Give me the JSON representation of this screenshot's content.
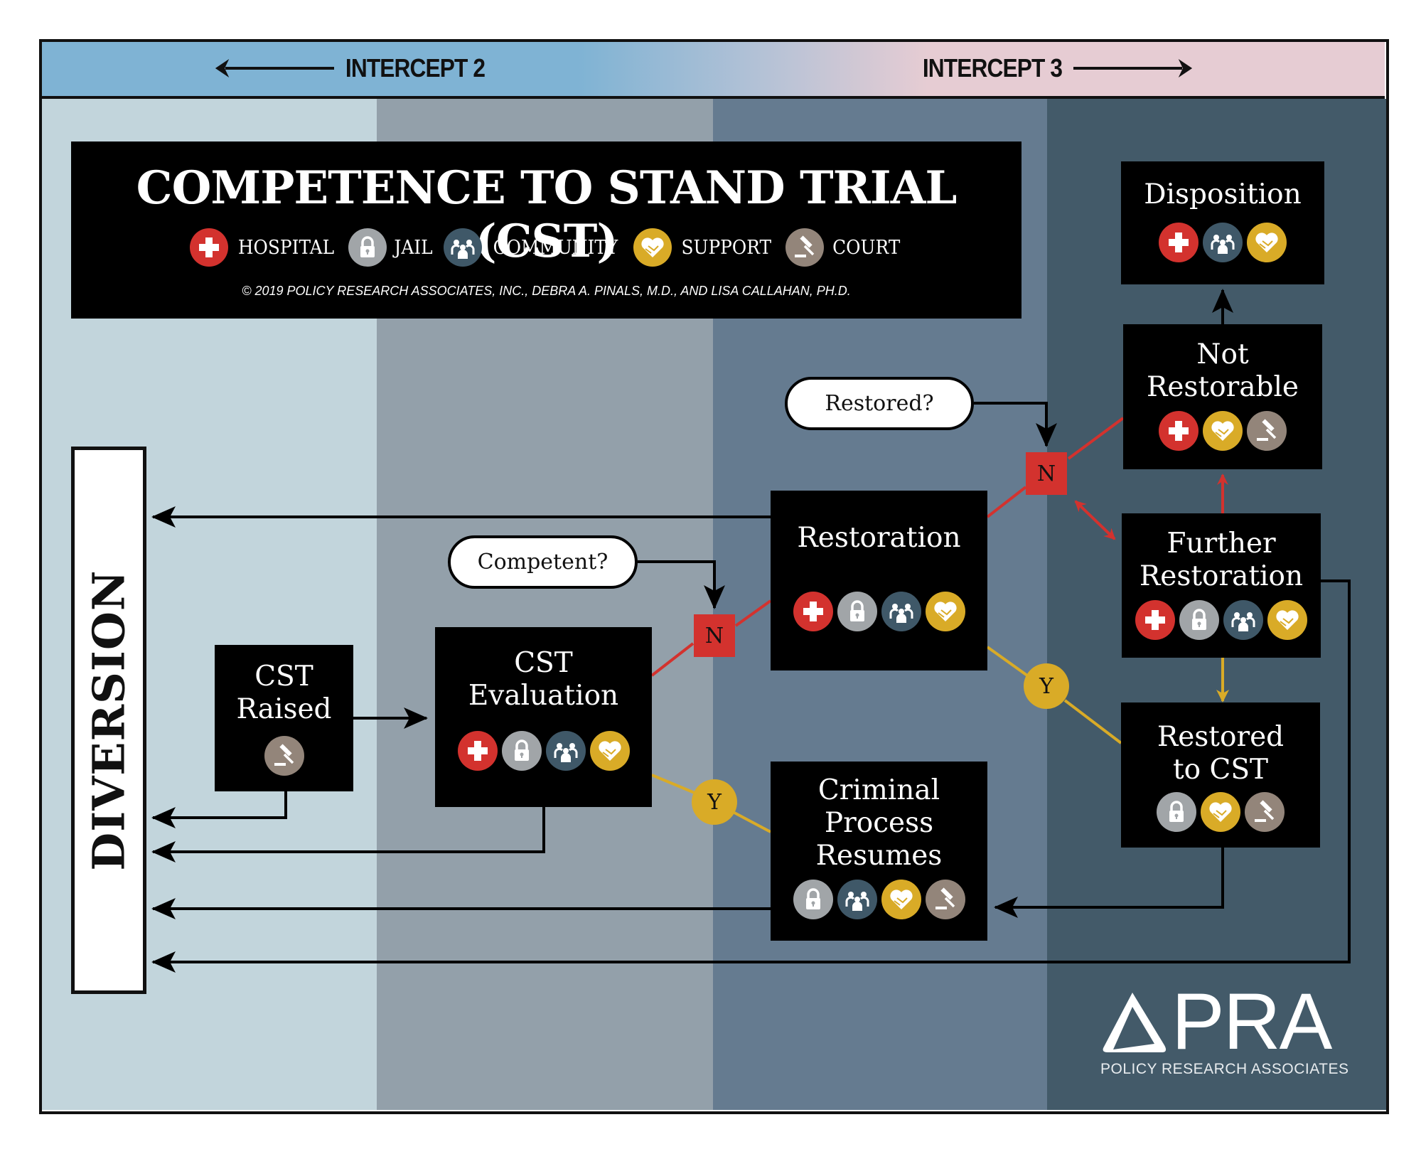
{
  "header": {
    "intercept_left": "INTERCEPT 2",
    "intercept_right": "INTERCEPT 3"
  },
  "colors": {
    "hospital": "#d3322e",
    "jail": "#a1a5a8",
    "community": "#3f5868",
    "support": "#d9ab27",
    "court": "#93857a",
    "no_path": "#d3322e",
    "yes_path": "#d9ab27",
    "col1": "#c2d5dc",
    "col2": "#93a0aa",
    "col3": "#657b90",
    "col4": "#435a69"
  },
  "title": {
    "text": "COMPETENCE TO STAND TRIAL (CST)",
    "copyright": "© 2019 POLICY RESEARCH ASSOCIATES, INC., DEBRA A. PINALS, M.D., AND LISA CALLAHAN, PH.D.",
    "legend": [
      {
        "icon": "hospital-icon",
        "label": "HOSPITAL"
      },
      {
        "icon": "jail-icon",
        "label": "JAIL"
      },
      {
        "icon": "community-icon",
        "label": "COMMUNITY"
      },
      {
        "icon": "support-icon",
        "label": "SUPPORT"
      },
      {
        "icon": "court-icon",
        "label": "COURT"
      }
    ]
  },
  "diversion": {
    "label": "DIVERSION"
  },
  "nodes": {
    "cst_raised": {
      "line1": "CST",
      "line2": "Raised",
      "icons": [
        "court"
      ]
    },
    "cst_evaluation": {
      "line1": "CST",
      "line2": "Evaluation",
      "icons": [
        "hospital",
        "jail",
        "community",
        "support"
      ]
    },
    "restoration": {
      "line1": "Restoration",
      "icons": [
        "hospital",
        "jail",
        "community",
        "support"
      ]
    },
    "criminal_process": {
      "line1": "Criminal",
      "line2": "Process",
      "line3": "Resumes",
      "icons": [
        "jail",
        "community",
        "support",
        "court"
      ]
    },
    "disposition": {
      "line1": "Disposition",
      "icons": [
        "hospital",
        "community",
        "support"
      ]
    },
    "not_restorable": {
      "line1": "Not",
      "line2": "Restorable",
      "icons": [
        "hospital",
        "support",
        "court"
      ]
    },
    "further_restoration": {
      "line1": "Further",
      "line2": "Restoration",
      "icons": [
        "hospital",
        "jail",
        "community",
        "support"
      ]
    },
    "restored_to_cst": {
      "line1": "Restored",
      "line2": "to CST",
      "icons": [
        "jail",
        "support",
        "court"
      ]
    }
  },
  "decisions": {
    "competent": "Competent?",
    "restored": "Restored?",
    "no_label": "N",
    "yes_label": "Y"
  },
  "logo": {
    "wordmark": "PRA",
    "subtitle": "POLICY RESEARCH ASSOCIATES"
  }
}
